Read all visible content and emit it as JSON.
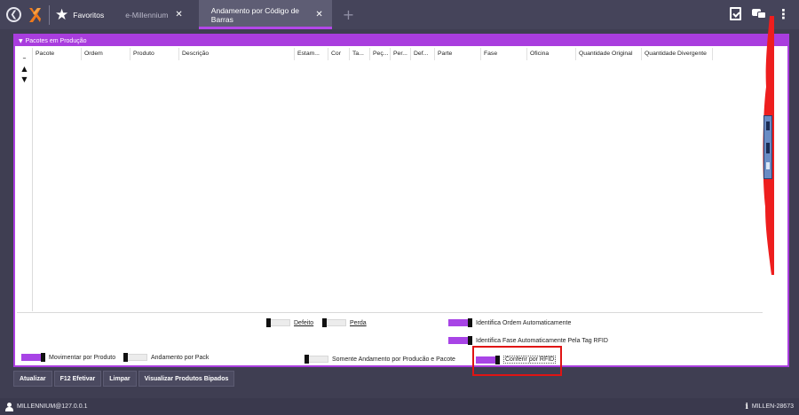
{
  "topbar": {
    "favorites_label": "Favoritos",
    "tabs": [
      {
        "label": "e-Millennium",
        "active": false
      },
      {
        "label": "Andamento por Código de Barras",
        "active": true
      }
    ],
    "close_glyph": "✕",
    "add_glyph": "+",
    "icons": [
      "back-icon",
      "millennium-logo-icon",
      "star-icon",
      "clipboard-check-icon",
      "chat-icon",
      "kebab-menu-icon"
    ]
  },
  "panel": {
    "title": "Pacotes em Produção",
    "side_controls": [
      "–",
      "▲",
      "▼"
    ],
    "columns": [
      "Pacote",
      "Ordem",
      "Produto",
      "Descrição",
      "Estam...",
      "Cor",
      "Ta...",
      "Peç...",
      "Per...",
      "Def...",
      "Parte",
      "Fase",
      "Oficina",
      "Quantidade Original",
      "Quantidade Divergente"
    ]
  },
  "options": {
    "defeito": {
      "label": "Defeito",
      "checked": false
    },
    "perda": {
      "label": "Perda",
      "checked": false
    },
    "identifica_ordem": {
      "label": "Identifica Ordem Automaticamente",
      "checked": true
    },
    "identifica_fase": {
      "label": "Identifica Fase Automaticamente Pela Tag RFID",
      "checked": true
    },
    "movimentar_produto": {
      "label": "Movimentar por Produto",
      "checked": true
    },
    "andamento_pack": {
      "label": "Andamento por Pack",
      "checked": false
    },
    "somente_andamento": {
      "label": "Somente Andamento por Producão e Pacote",
      "checked": false
    },
    "conferir_rfid": {
      "label": "Conferir por RFID",
      "checked": true
    }
  },
  "buttons": {
    "atualizar": "Atualizar",
    "f12_efetivar": "F12 Efetivar",
    "limpar": "Limpar",
    "visualizar": "Visualizar Produtos Bipados"
  },
  "status": {
    "user": "MILLENNIUM@127.0.0.1",
    "server": "MILLEN-28673"
  },
  "colors": {
    "accent": "#a93dde",
    "toggle_on": "#a844e6",
    "highlight": "#e01414",
    "topbar": "#45445a"
  }
}
